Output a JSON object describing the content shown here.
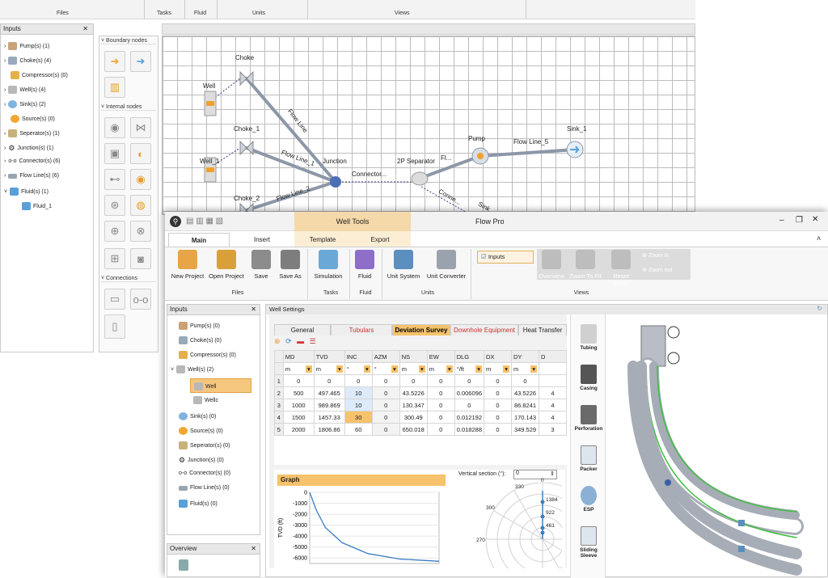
{
  "colors": {
    "accent": "#f5c77e",
    "flowline": "#8c97a8",
    "tab_active": "#f6c26b",
    "red_tab": "#cc3333"
  },
  "background_window": {
    "ribbon_groups": [
      "Files",
      "Tasks",
      "Fluid",
      "Units",
      "Views"
    ],
    "inputs_panel": {
      "title": "Inputs",
      "items": [
        "Pump(s) (1)",
        "Choke(s) (4)",
        "Compressor(s) (0)",
        "Well(s) (4)",
        "Sink(s) (2)",
        "Source(s) (0)",
        "Seperator(s) (1)",
        "Junction(s) (1)",
        "Connector(s) (6)",
        "Flow Line(s) (6)",
        "Fluid(s) (1)"
      ],
      "child": "Fluid_1"
    },
    "nodes_panel": {
      "boundary": "Boundary nodes",
      "internal": "Internal nodes",
      "connections": "Connections"
    },
    "canvas_labels": {
      "choke": "Choke",
      "well": "Well",
      "choke_1": "Choke_1",
      "well_1": "Well_1",
      "choke_2": "Choke_2",
      "flow_line": "Flow Line",
      "flow_line_1": "Flow Line_1",
      "flow_line_2": "Flow Line_2",
      "junction": "Junction",
      "connector": "Connector...",
      "separator": "2P Separator",
      "fl": "Fl...",
      "pump": "Pump",
      "flow_line_5": "Flow Line_5",
      "sink_1": "Sink_1",
      "conne": "Conne...",
      "sink": "Sink"
    }
  },
  "foreground_window": {
    "title": "Flow Pro",
    "context_tab": "Well Tools",
    "tabs": [
      "Main",
      "Insert",
      "Template",
      "Export"
    ],
    "ribbon_buttons": [
      "New Project",
      "Open Project",
      "Save",
      "Save As",
      "Simulation",
      "Fluid",
      "Unit System",
      "Unit Converter"
    ],
    "groups": [
      "Files",
      "Tasks",
      "Fluid",
      "Units",
      "Views"
    ],
    "inputs_check": "Inputs",
    "view_buttons": [
      "Overview",
      "Zoom To Fit",
      "Reset Zoom"
    ],
    "zoom": [
      "Zoom in",
      "Zoom out"
    ],
    "inputs_panel": {
      "title": "Inputs",
      "items": [
        "Pump(s) (0)",
        "Choke(s) (0)",
        "Compressor(s) (0)",
        "Well(s) (2)",
        "Well",
        "Wellc",
        "Sink(s) (0)",
        "Source(s) (0)",
        "Seperator(s) (0)",
        "Junction(s) (0)",
        "Connector(s) (0)",
        "Flow Line(s) (0)",
        "Fluid(s) (0)"
      ]
    },
    "overview_title": "Overview",
    "well_settings": {
      "title": "Well Settings",
      "tabs": [
        "General",
        "Tubulars",
        "Deviation Survey",
        "Downhole Equipment",
        "Heat Transfer"
      ],
      "columns": [
        "MD",
        "TVD",
        "INC",
        "AZM",
        "NS",
        "EW",
        "DLG",
        "DX",
        "DY",
        "D"
      ],
      "units": [
        "m",
        "m",
        "°",
        "°",
        "m",
        "m",
        "°/ft",
        "m",
        "m"
      ],
      "rows": [
        [
          "1",
          "0",
          "0",
          "0",
          "0",
          "0",
          "0",
          "0",
          "0",
          "0"
        ],
        [
          "2",
          "500",
          "497.465",
          "10",
          "0",
          "43.5226",
          "0",
          "0.006096",
          "0",
          "43.5226"
        ],
        [
          "3",
          "1000",
          "989.869",
          "10",
          "0",
          "130.347",
          "0",
          "0",
          "0",
          "86.8241"
        ],
        [
          "4",
          "1500",
          "1457.33",
          "30",
          "0",
          "300.49",
          "0",
          "0.012192",
          "0",
          "170.143"
        ],
        [
          "5",
          "2000",
          "1806.86",
          "60",
          "0",
          "650.018",
          "0",
          "0.018288",
          "0",
          "349.529"
        ]
      ],
      "extra_col": [
        "",
        "4",
        "4",
        "4",
        "3"
      ],
      "graph_title": "Graph",
      "vertical_section_label": "Vertical section (°):",
      "vertical_section_value": "0",
      "polar_labels": [
        "330",
        "300",
        "270",
        "1384",
        "922",
        "461",
        "0"
      ],
      "tools": [
        "Tubing",
        "Casing",
        "Perforation",
        "Packer",
        "ESP",
        "Sliding Sleeve"
      ]
    }
  },
  "chart_data": {
    "type": "line",
    "title": "",
    "xlabel": "",
    "ylabel": "TVD (ft)",
    "ylim": [
      -6500,
      0
    ],
    "yticks": [
      "0",
      "-1000",
      "-2000",
      "-3000",
      "-4000",
      "-5000",
      "-6000"
    ],
    "series": [
      {
        "x": [
          0,
          0.05,
          0.12,
          0.25,
          0.45,
          0.7,
          1.0
        ],
        "y": [
          0,
          -1600,
          -3200,
          -4600,
          -5600,
          -6100,
          -6300
        ]
      }
    ]
  }
}
